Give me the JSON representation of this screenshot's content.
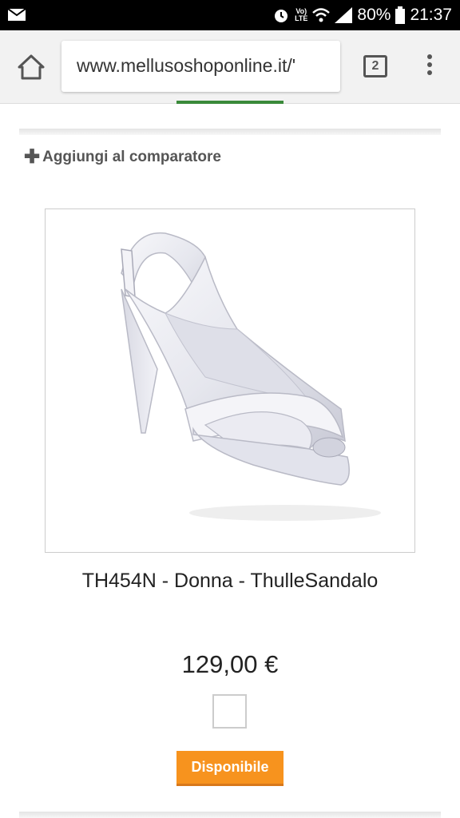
{
  "status_bar": {
    "volte_label": "Vo)",
    "lte_label": "LTE",
    "battery": "80%",
    "time": "21:37"
  },
  "browser": {
    "url": "www.mellusoshoponline.it/'",
    "tab_count": "2"
  },
  "page": {
    "compare_label": "Aggiungi al comparatore",
    "product_title": "TH454N - Donna - ThulleSandalo",
    "price": "129,00 €",
    "availability_label": "Disponibile"
  },
  "colors": {
    "availability_badge": "#f7931e",
    "accent_green": "#3a8a3a"
  }
}
